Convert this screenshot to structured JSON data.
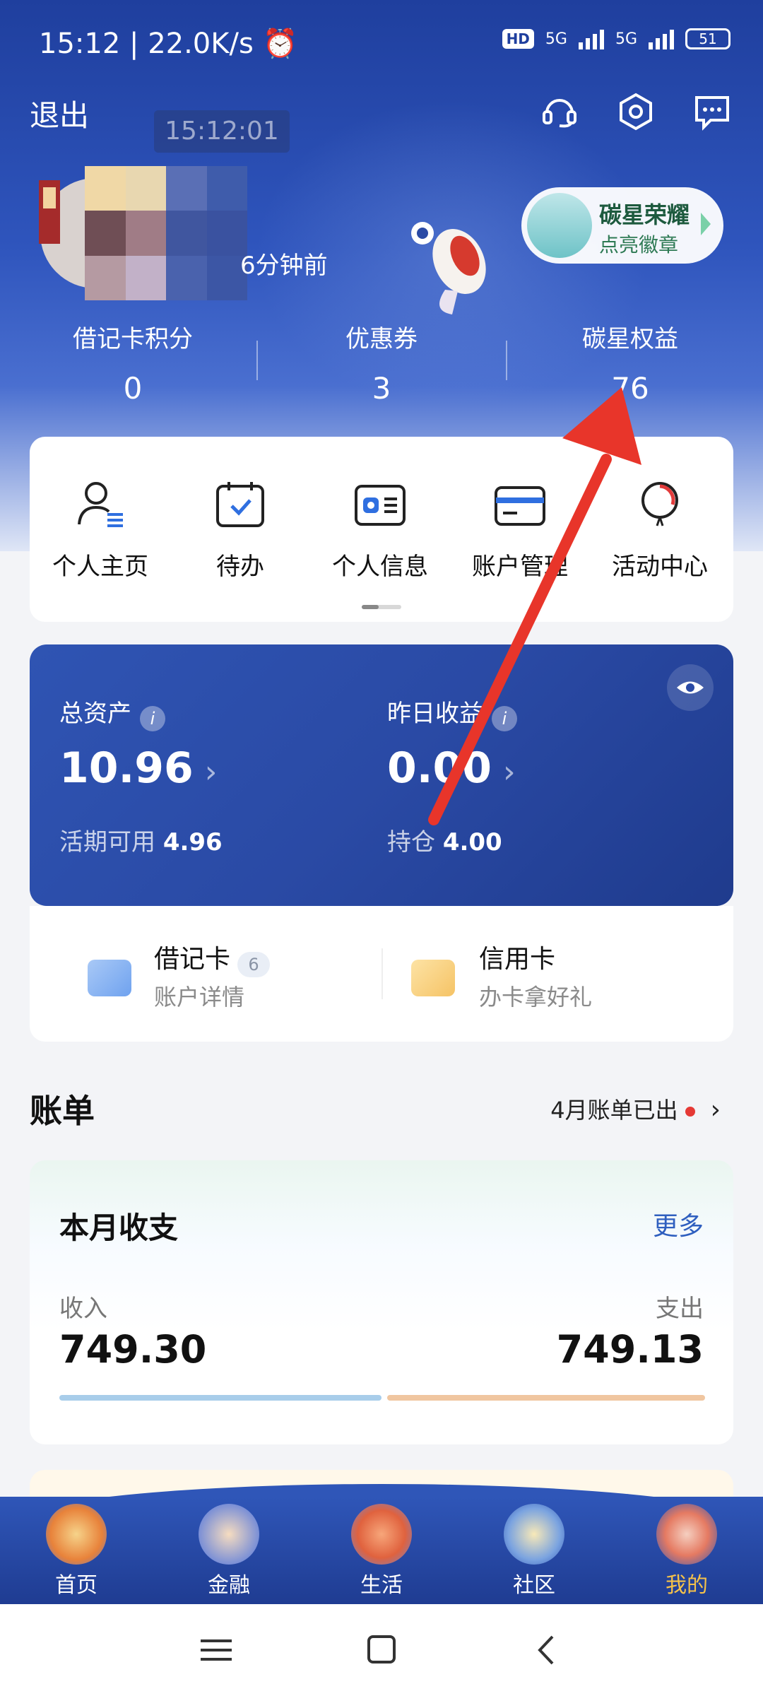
{
  "status_bar": {
    "time": "15:12",
    "speed": "22.0K/s",
    "hd": "HD",
    "net1": "5G",
    "net2": "5G",
    "battery": "51"
  },
  "header": {
    "logout": "退出",
    "clock_overlay": "15:12:01",
    "last_login": "6分钟前"
  },
  "badge": {
    "title": "碳星荣耀",
    "subtitle": "点亮徽章"
  },
  "stats": [
    {
      "label": "借记卡积分",
      "value": "0"
    },
    {
      "label": "优惠券",
      "value": "3"
    },
    {
      "label": "碳星权益",
      "value": "76"
    }
  ],
  "menu": [
    {
      "label": "个人主页",
      "icon": "person-icon"
    },
    {
      "label": "待办",
      "icon": "calendar-check-icon"
    },
    {
      "label": "个人信息",
      "icon": "id-card-icon"
    },
    {
      "label": "账户管理",
      "icon": "card-icon"
    },
    {
      "label": "活动中心",
      "icon": "balloon-icon"
    }
  ],
  "assets": {
    "total_label": "总资产",
    "total_value": "10.96",
    "yesterday_label": "昨日收益",
    "yesterday_value": "0.00",
    "current_label": "活期可用",
    "current_value": "4.96",
    "holding_label": "持仓",
    "holding_value": "4.00"
  },
  "cards": {
    "debit_title": "借记卡",
    "debit_count": "6",
    "debit_sub": "账户详情",
    "credit_title": "信用卡",
    "credit_sub": "办卡拿好礼"
  },
  "bill": {
    "section_title": "账单",
    "notice": "4月账单已出",
    "card_title": "本月收支",
    "more": "更多",
    "income_label": "收入",
    "income_value": "749.30",
    "expense_label": "支出",
    "expense_value": "749.13"
  },
  "nav": [
    {
      "label": "首页",
      "icon": "home-icon"
    },
    {
      "label": "金融",
      "icon": "finance-icon"
    },
    {
      "label": "生活",
      "icon": "life-icon"
    },
    {
      "label": "社区",
      "icon": "community-icon"
    },
    {
      "label": "我的",
      "icon": "mine-icon"
    }
  ],
  "colors": {
    "brand": "#2a4aa5",
    "active_tab": "#f5c24a",
    "arrow": "#e8352a"
  }
}
